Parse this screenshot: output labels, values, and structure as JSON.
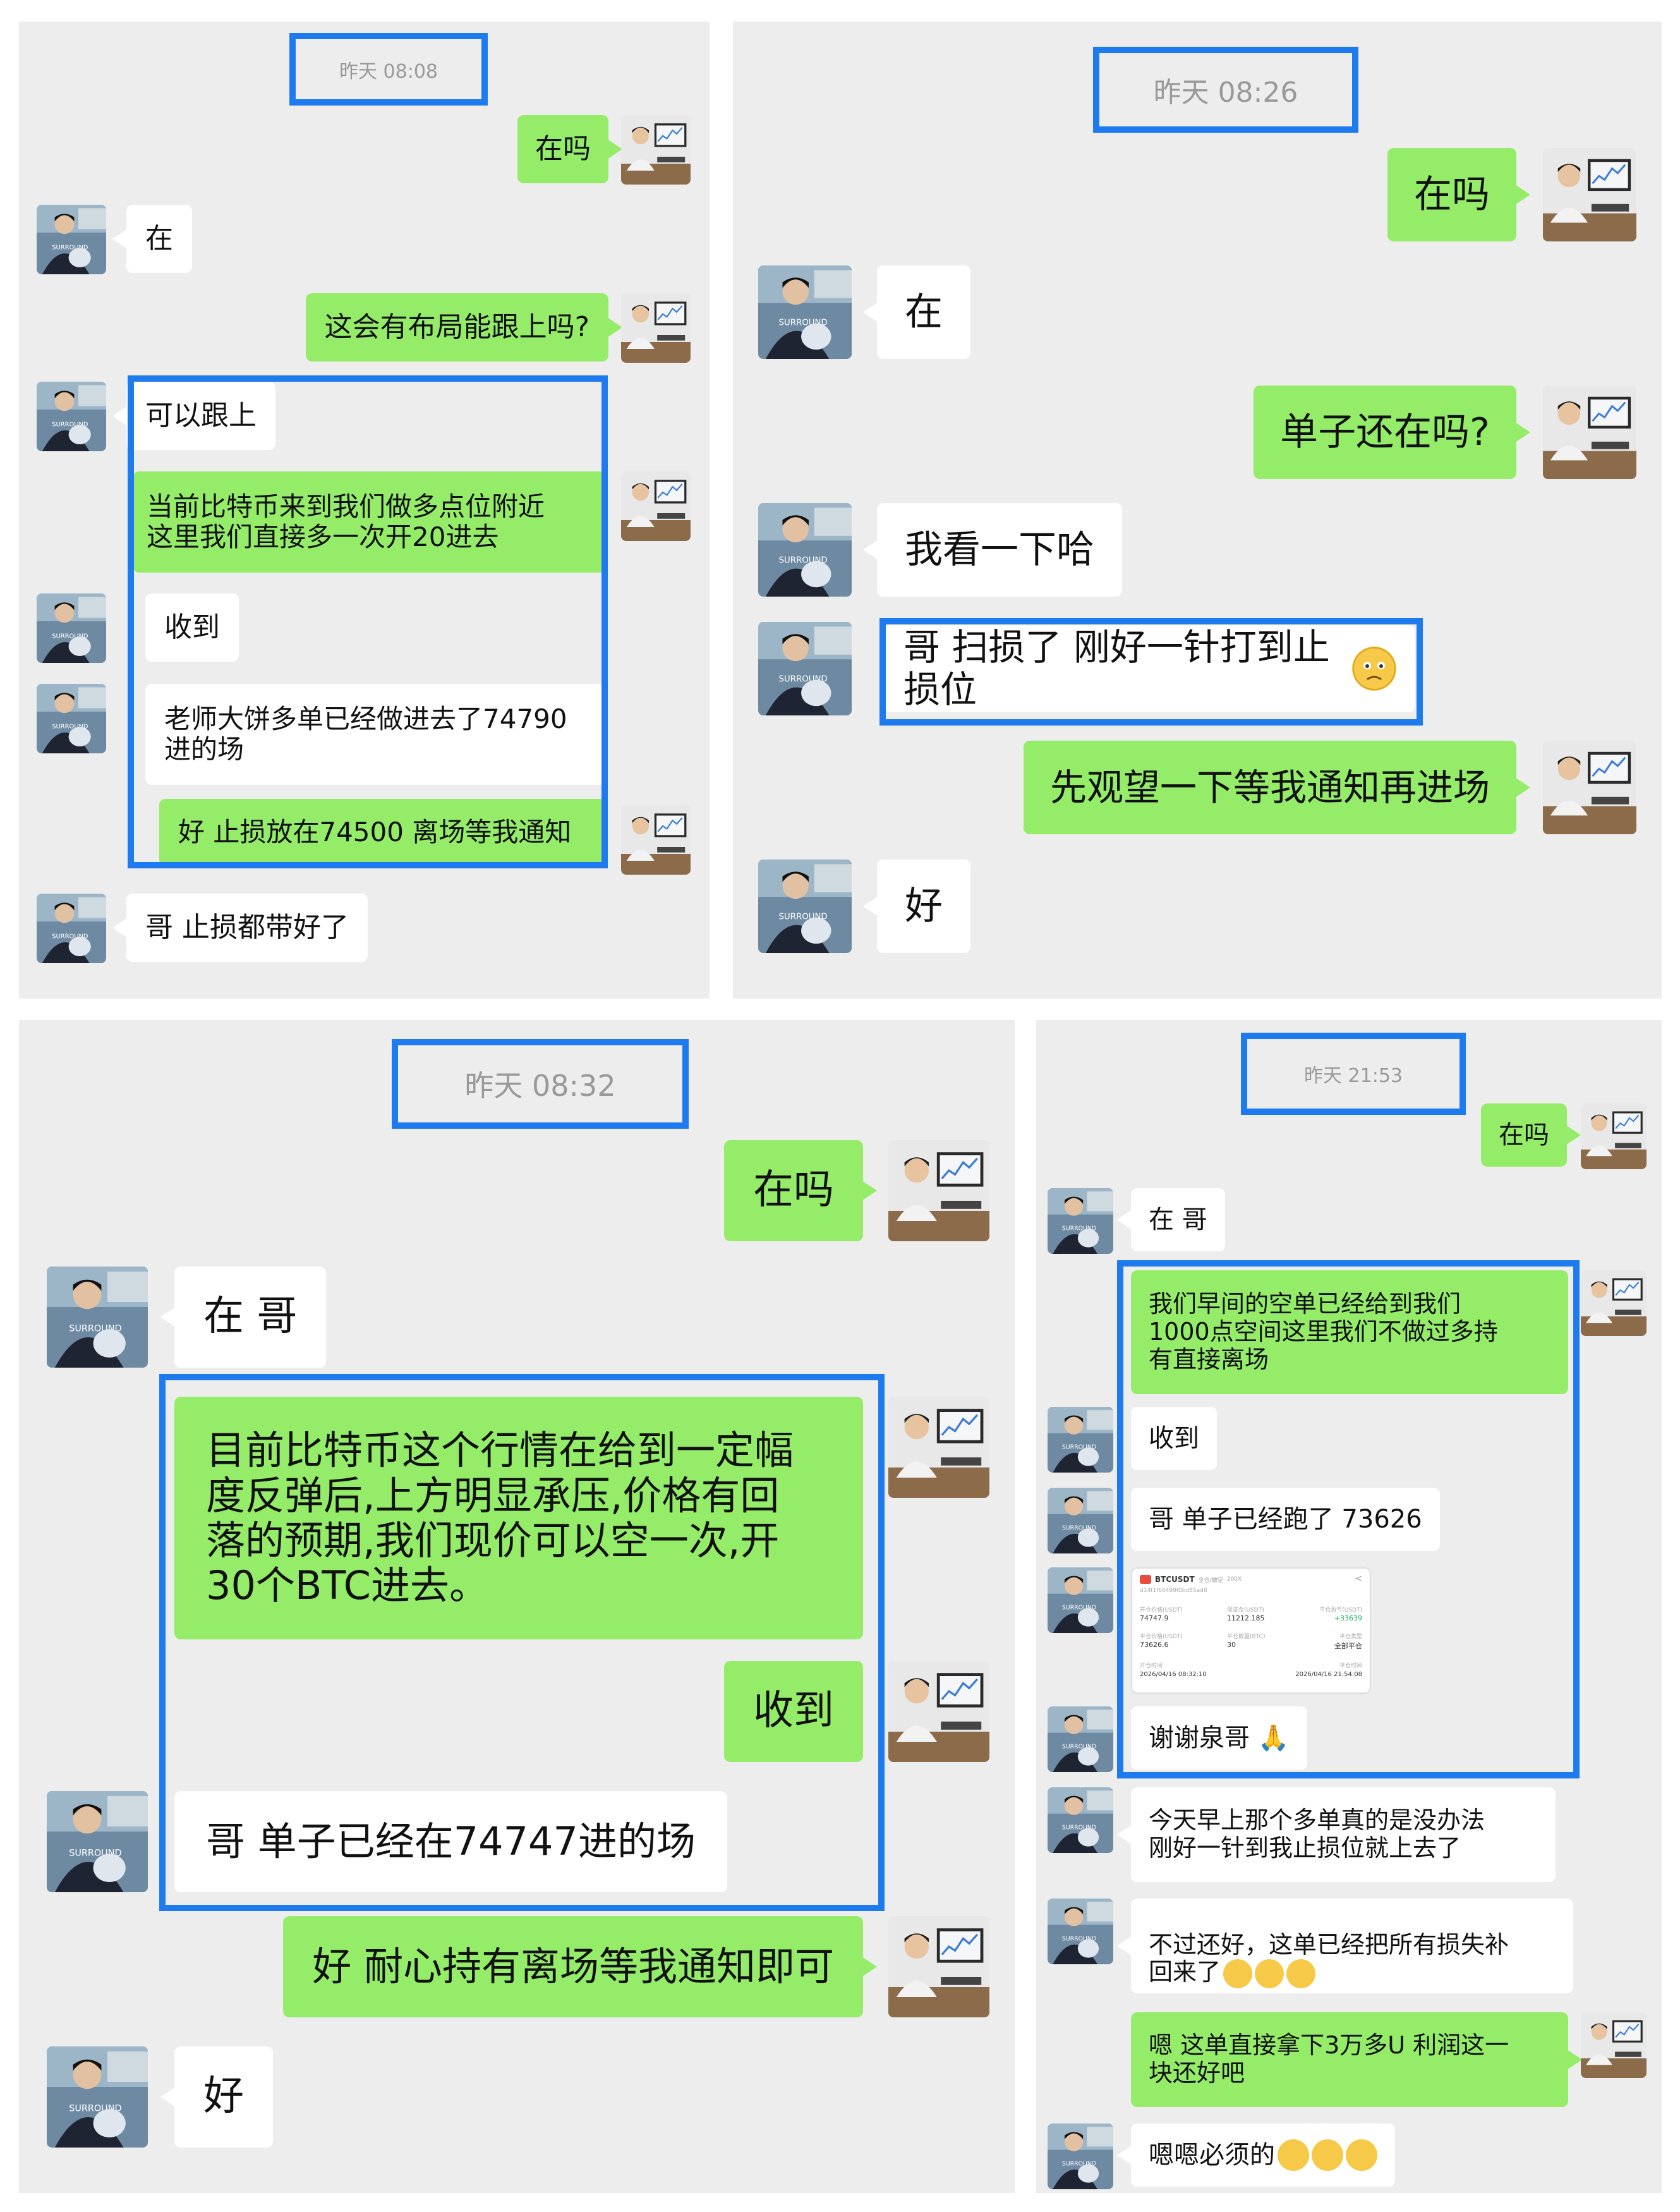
{
  "panel1": {
    "timestamp": "昨天 08:08",
    "messages": [
      {
        "side": "right",
        "text": "在吗"
      },
      {
        "side": "left",
        "text": "在"
      },
      {
        "side": "right",
        "text": "这会有布局能跟上吗?"
      },
      {
        "side": "left",
        "text": "可以跟上"
      },
      {
        "side": "right",
        "text": "当前比特币来到我们做多点位附近\n这里我们直接多一次开20进去"
      },
      {
        "side": "left",
        "text": "收到"
      },
      {
        "side": "left",
        "text": "老师大饼多单已经做进去了74790\n进的场"
      },
      {
        "side": "right",
        "text": "好 止损放在74500  离场等我通知"
      },
      {
        "side": "left",
        "text": "哥 止损都带好了"
      }
    ]
  },
  "panel2": {
    "timestamp": "昨天 08:26",
    "messages": [
      {
        "side": "right",
        "text": "在吗"
      },
      {
        "side": "left",
        "text": "在"
      },
      {
        "side": "right",
        "text": "单子还在吗?"
      },
      {
        "side": "left",
        "text": "我看一下哈"
      },
      {
        "side": "left",
        "text": "哥 扫损了 刚好一针打到止损位"
      },
      {
        "side": "right",
        "text": "先观望一下等我通知再进场"
      },
      {
        "side": "left",
        "text": "好"
      }
    ]
  },
  "panel3": {
    "timestamp": "昨天 08:32",
    "messages": [
      {
        "side": "right",
        "text": "在吗"
      },
      {
        "side": "left",
        "text": "在 哥"
      },
      {
        "side": "right",
        "text": "目前比特币这个行情在给到一定幅\n度反弹后,上方明显承压,价格有回\n落的预期,我们现价可以空一次,开\n30个BTC进去。"
      },
      {
        "side": "right",
        "text": "收到"
      },
      {
        "side": "left",
        "text": "哥 单子已经在74747进的场"
      },
      {
        "side": "right",
        "text": "好 耐心持有离场等我通知即可"
      },
      {
        "side": "left",
        "text": "好"
      }
    ]
  },
  "panel4": {
    "timestamp": "昨天 21:53",
    "messages": [
      {
        "side": "right",
        "text": "在吗"
      },
      {
        "side": "left",
        "text": "在 哥"
      },
      {
        "side": "right",
        "text": "我们早间的空单已经给到我们\n1000点空间这里我们不做过多持\n有直接离场"
      },
      {
        "side": "left",
        "text": "收到"
      },
      {
        "side": "left",
        "text": "哥  单子已经跑了 73626"
      },
      {
        "side": "left",
        "text": "谢谢泉哥 🙏"
      },
      {
        "side": "left",
        "text": "今天早上那个多单真的是没办法\n刚好一针到我止损位就上去了"
      },
      {
        "side": "left",
        "text": "不过还好，这单已经把所有损失补\n回来了"
      },
      {
        "side": "right",
        "text": "嗯 这单直接拿下3万多U 利润这一\n块还好吧"
      },
      {
        "side": "left",
        "text": "嗯嗯必须的"
      }
    ],
    "trade_card": {
      "symbol": "BTCUSDT",
      "tag": "全仓/做空",
      "leverage": "200X",
      "order_id": "d14f1f66499f0bd85ad8",
      "labels": [
        "开仓价格(USDT)",
        "保证金(USDT)",
        "平仓盈亏(USDT)",
        "平仓价格(USDT)",
        "平仓数量(BTC)",
        "平仓类型",
        "开仓时间",
        "平仓时间"
      ],
      "values": [
        "74747.9",
        "11212.185",
        "+33639",
        "73626.6",
        "30",
        "全部平仓",
        "2026/04/16 08:32:10",
        "2026/04/16 21:54:08"
      ]
    }
  }
}
